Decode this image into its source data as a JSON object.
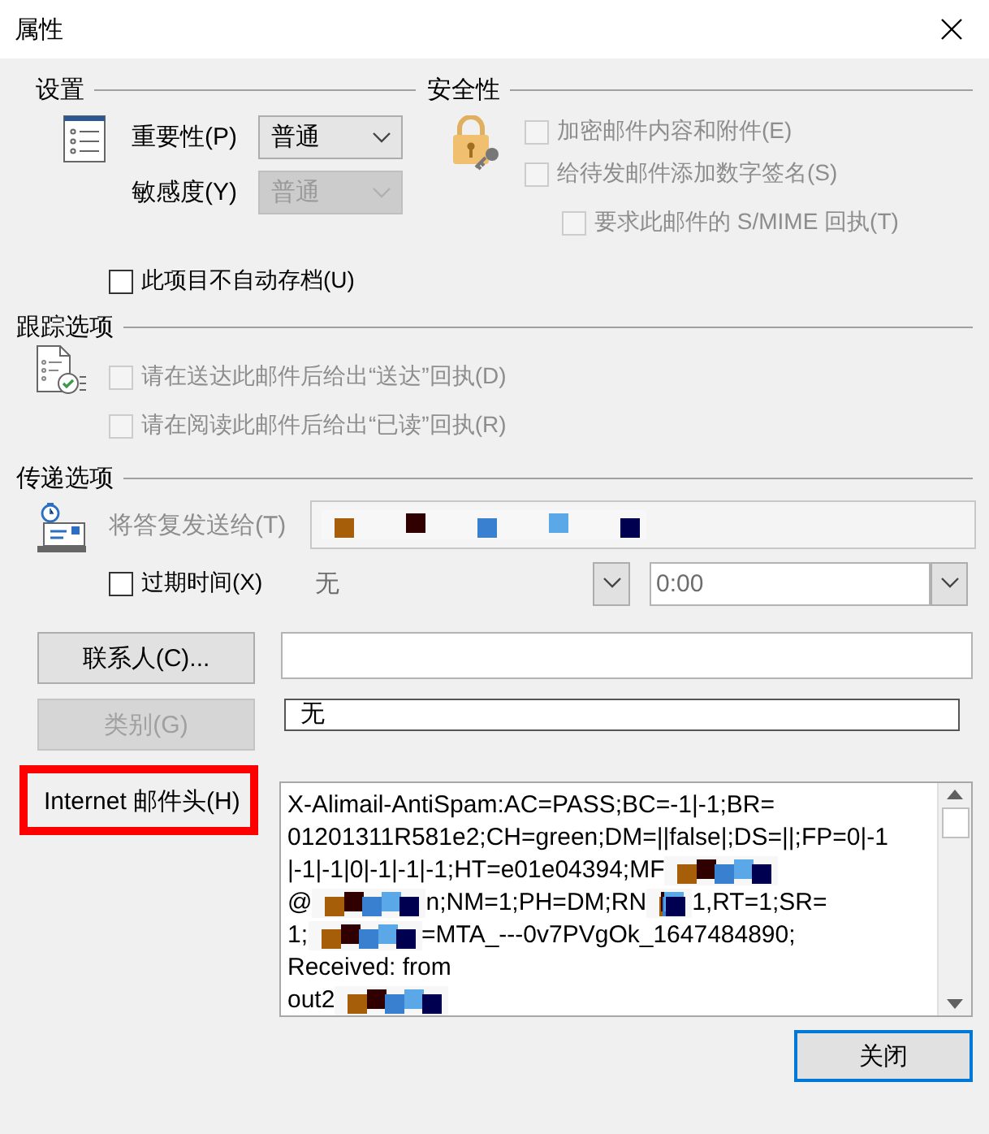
{
  "window": {
    "title": "属性"
  },
  "settings": {
    "heading": "设置",
    "importance": {
      "label": "重要性(P)",
      "value": "普通",
      "disabled": false
    },
    "sensitivity": {
      "label": "敏感度(Y)",
      "value": "普通",
      "disabled": true
    },
    "autoarchive": {
      "label": "此项目不自动存档(U)",
      "checked": false,
      "disabled": false
    }
  },
  "security": {
    "heading": "安全性",
    "options": [
      {
        "label": "加密邮件内容和附件(E)",
        "checked": false,
        "disabled": true
      },
      {
        "label": "给待发邮件添加数字签名(S)",
        "checked": false,
        "disabled": true,
        "children": [
          {
            "label": "要求此邮件的 S/MIME 回执(T)",
            "checked": false,
            "disabled": true
          }
        ]
      }
    ]
  },
  "tracking": {
    "heading": "跟踪选项",
    "options": [
      {
        "label": "请在送达此邮件后给出“送达”回执(D)",
        "checked": false,
        "disabled": true
      },
      {
        "label": "请在阅读此邮件后给出“已读”回执(R)",
        "checked": false,
        "disabled": true
      }
    ]
  },
  "delivery": {
    "heading": "传递选项",
    "reply_to": {
      "label": "将答复发送给(T)",
      "disabled": true
    },
    "expires": {
      "label": "过期时间(X)",
      "checked": false,
      "disabled": false,
      "date": "无",
      "time": "0:00"
    }
  },
  "contacts": {
    "button": "联系人(C)...",
    "disabled": false
  },
  "categories": {
    "button": "类别(G)",
    "disabled": true,
    "value": "无"
  },
  "internet_headers": {
    "label": "Internet 邮件头(H)",
    "highlighted": true,
    "lines": [
      {
        "parts": [
          {
            "kind": "text",
            "text": "X-Alimail-AntiSpam:AC=PASS;BC=-1|-1;BR="
          }
        ]
      },
      {
        "parts": [
          {
            "kind": "text",
            "text": "01201311R581e2;CH=green;DM=||false|;DS=||;FP=0|-1"
          }
        ]
      },
      {
        "parts": [
          {
            "kind": "text",
            "text": "|-1|-1|0|-1|-1|-1;HT=e01e04394;MF"
          },
          {
            "kind": "redaction"
          }
        ]
      },
      {
        "parts": [
          {
            "kind": "text",
            "text": "@"
          },
          {
            "kind": "redaction"
          },
          {
            "kind": "text",
            "text": "n;NM=1;PH=DM;RN"
          },
          {
            "kind": "redaction"
          },
          {
            "kind": "text",
            "text": "1,RT=1;SR="
          }
        ]
      },
      {
        "parts": [
          {
            "kind": "text",
            "text": "1;"
          },
          {
            "kind": "redaction"
          },
          {
            "kind": "text",
            "text": "=MTA_---0v7PVgOk_1647484890;"
          }
        ]
      },
      {
        "parts": [
          {
            "kind": "text",
            "text": "Received: from"
          }
        ]
      },
      {
        "parts": [
          {
            "kind": "text",
            "text": "out2"
          },
          {
            "kind": "redaction"
          }
        ]
      }
    ]
  },
  "buttons": [
    {
      "label": "关闭",
      "default": true
    }
  ]
}
